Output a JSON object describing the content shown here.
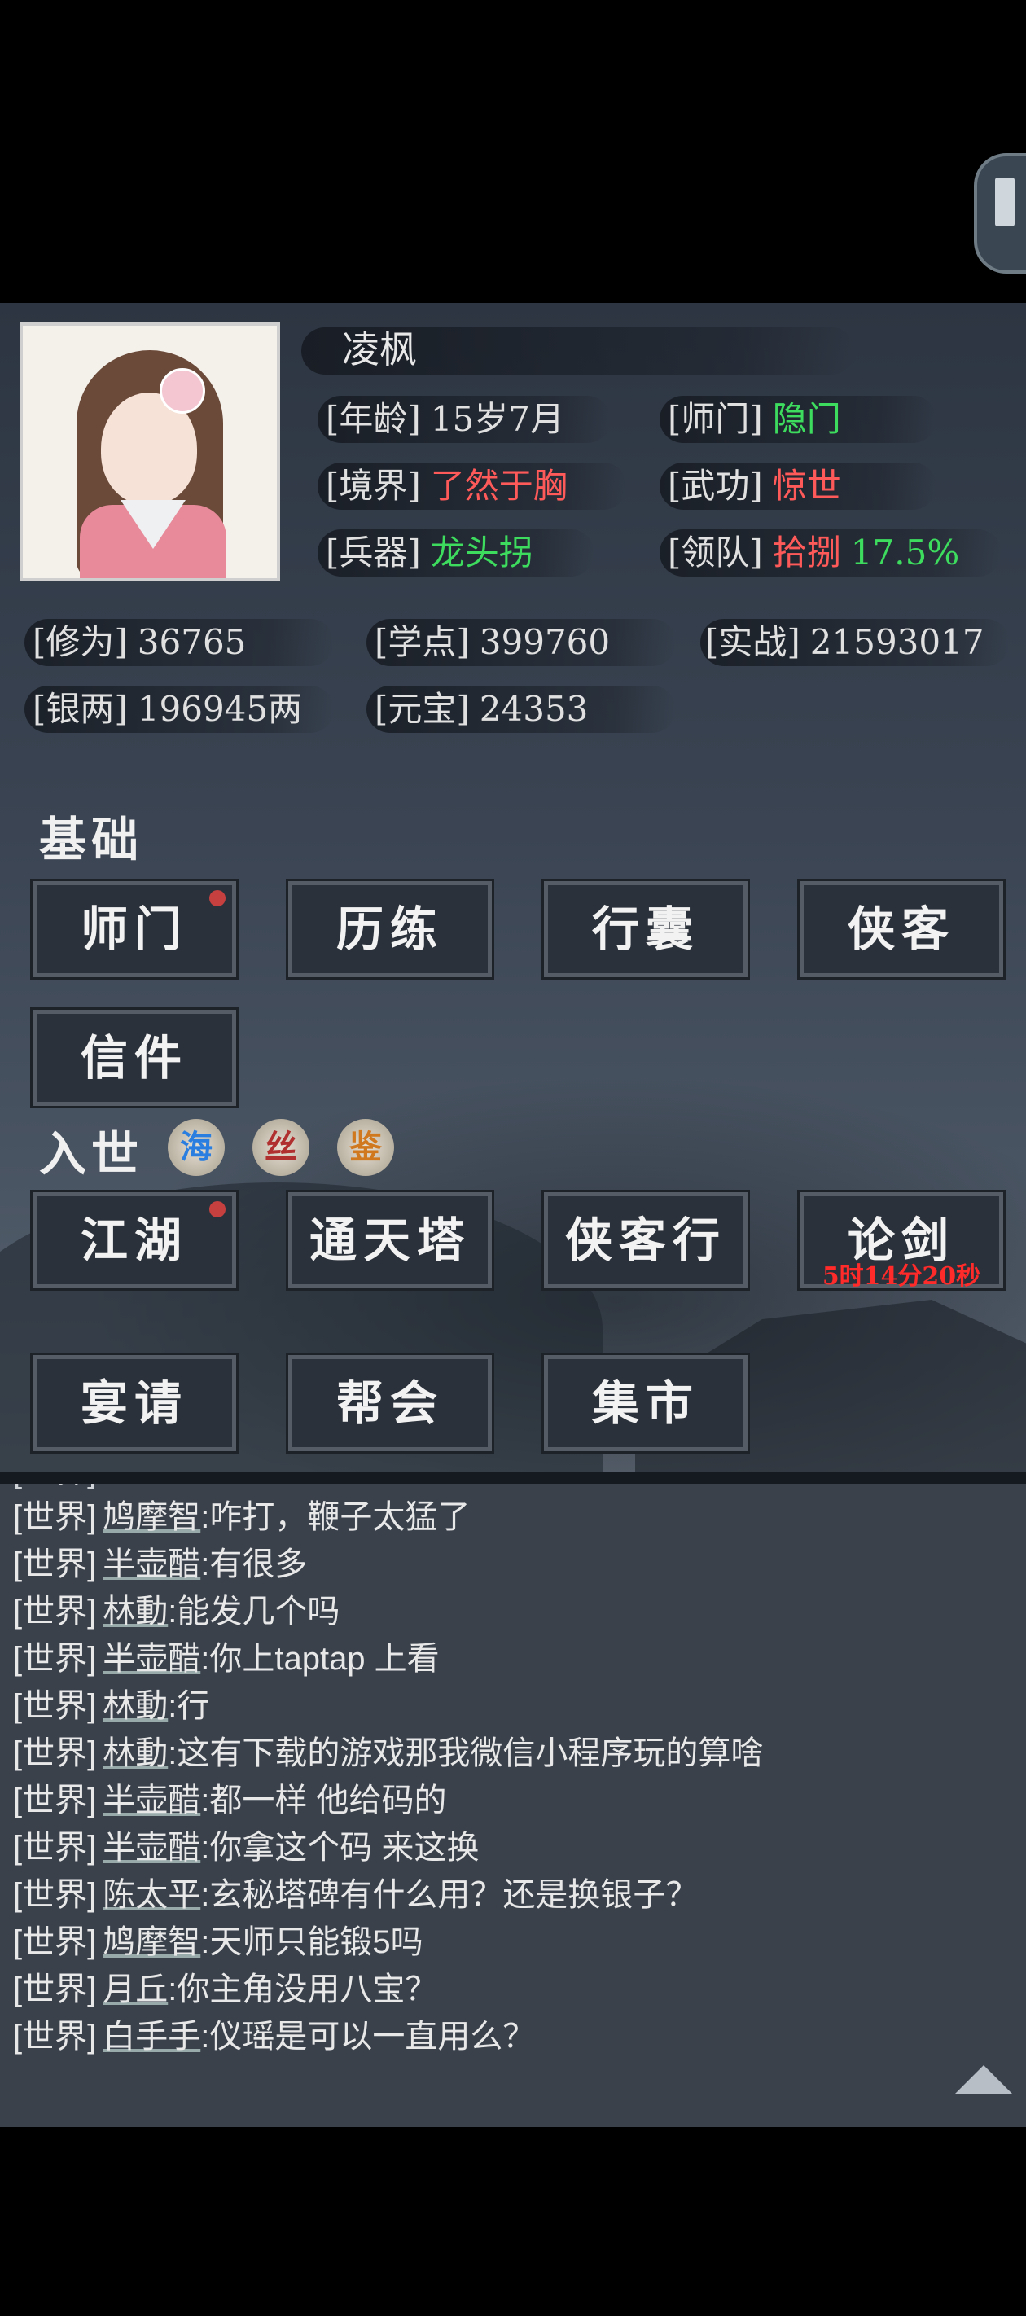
{
  "profile": {
    "name": "凌枫",
    "age": {
      "label": "[年龄]",
      "value": "15岁7月"
    },
    "sect": {
      "label": "[师门]",
      "value": "隐门"
    },
    "realm": {
      "label": "[境界]",
      "value": "了然于胸"
    },
    "martial": {
      "label": "[武功]",
      "value": "惊世"
    },
    "weapon": {
      "label": "[兵器]",
      "value": "龙头拐"
    },
    "team": {
      "label": "[领队]",
      "value": "拾捌",
      "percent": "17.5%"
    }
  },
  "stats": {
    "cultivation": {
      "label": "[修为]",
      "value": "36765"
    },
    "study": {
      "label": "[学点]",
      "value": "399760"
    },
    "combat": {
      "label": "[实战]",
      "value": "21593017"
    },
    "silver": {
      "label": "[银两]",
      "value": "196945两"
    },
    "ingot": {
      "label": "[元宝]",
      "value": "24353"
    }
  },
  "basics": {
    "title": "基础",
    "buttons": [
      "师门",
      "历练",
      "行囊",
      "侠客",
      "信件"
    ]
  },
  "world": {
    "title": "入世",
    "badges": [
      "海",
      "丝",
      "鉴"
    ],
    "buttons": [
      "江湖",
      "通天塔",
      "侠客行",
      "论剑",
      "宴请",
      "帮会",
      "集市"
    ],
    "duel_timer": "5时14分20秒"
  },
  "chat": {
    "channel": "[世界]",
    "messages": [
      {
        "user": "鸠摩智",
        "text": ":咋打，鞭子太猛了"
      },
      {
        "user": "半壶醋",
        "text": ":有很多"
      },
      {
        "user": "林動",
        "text": ":能发几个吗"
      },
      {
        "user": "半壶醋",
        "text": ":你上taptap 上看"
      },
      {
        "user": "林動",
        "text": ":行"
      },
      {
        "user": "林動",
        "text": ":这有下载的游戏那我微信小程序玩的算啥"
      },
      {
        "user": "半壶醋",
        "text": ":都一样 他给码的"
      },
      {
        "user": "半壶醋",
        "text": ":你拿这个码  来这换"
      },
      {
        "user": "陈太平",
        "text": ":玄秘塔碑有什么用？还是换银子？"
      },
      {
        "user": "鸠摩智",
        "text": ":天师只能锻5吗"
      },
      {
        "user": "月丘",
        "text": ":你主角没用八宝？"
      },
      {
        "user": "白手手",
        "text": ":仪瑶是可以一直用么？"
      }
    ]
  },
  "colors": {
    "positive": "#3ddb5e",
    "negative": "#ff5a5a",
    "timer": "#ff2a2a",
    "notify": "#c64040"
  }
}
